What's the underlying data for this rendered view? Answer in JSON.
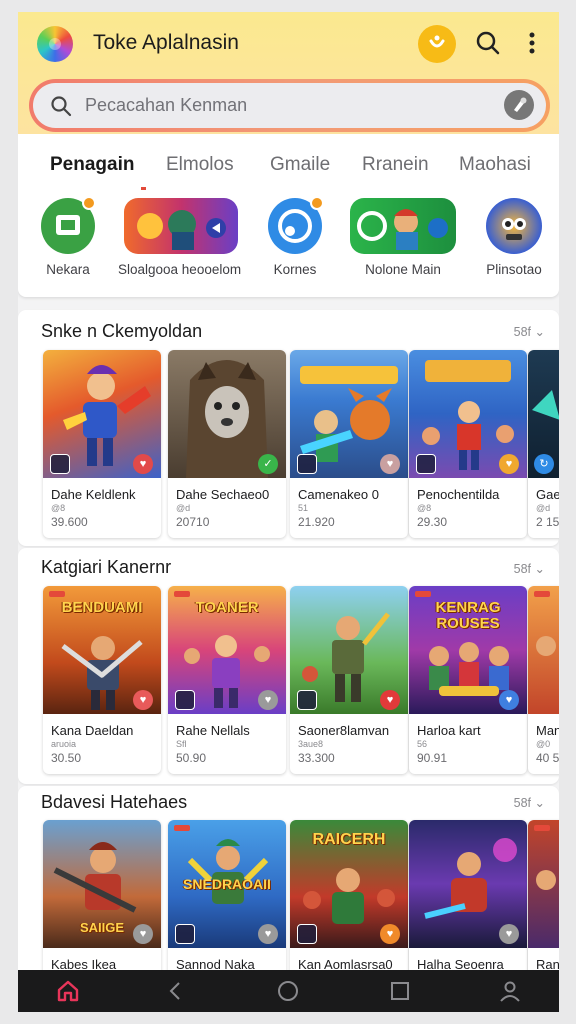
{
  "header": {
    "app_title": "Toke Aplalnasin",
    "icons": [
      "app-logo",
      "notification-icon",
      "search-icon",
      "more-icon"
    ]
  },
  "search": {
    "placeholder": "Pecacahan Kenman",
    "icon": "search-icon",
    "right_icon": "mic-icon"
  },
  "tabs": [
    {
      "label": "Penagain",
      "active": true
    },
    {
      "label": "Elmolos",
      "active": false
    },
    {
      "label": "Gmaile",
      "active": false
    },
    {
      "label": "Rranein",
      "active": false
    },
    {
      "label": "Maohasi",
      "active": false
    }
  ],
  "categories": [
    {
      "label": "Nekara",
      "color": "#3aa144"
    },
    {
      "label": "Sloalgooa heooelom",
      "color": "#e24c3c"
    },
    {
      "label": "Kornes",
      "color": "#2f8be5"
    },
    {
      "label": "Nolone Main",
      "color": "#2eb04a"
    },
    {
      "label": "Plinsotao",
      "color": "#3a5fd0"
    }
  ],
  "sections": [
    {
      "title": "Snke n Ckemyoldan",
      "more": "58f",
      "cards": [
        {
          "title": "Dahe Keldlenk",
          "sub": "@8",
          "value": "39.600",
          "fav_color": "#e24a4a"
        },
        {
          "title": "Dahe Sechaeo0",
          "sub": "@d",
          "value": "20710",
          "fav_color": "#39b54a"
        },
        {
          "title": "Camenakeo 0",
          "sub": "51",
          "value": "21.920",
          "fav_color": "#c9a0a0"
        },
        {
          "title": "Penochentilda",
          "sub": "@8",
          "value": "29.30",
          "fav_color": "#f0a830"
        },
        {
          "title": "Gae",
          "sub": "@d",
          "value": "2 15",
          "fav_color": "#2f8be5"
        }
      ]
    },
    {
      "title": "Katgiari Kanernr",
      "more": "58f",
      "cards": [
        {
          "title": "Kana Daeldan",
          "sub": "aruoia",
          "value": "30.50",
          "fav_color": "#e85a5a",
          "wordmark": "BENDUAMI"
        },
        {
          "title": "Rahe Nellals",
          "sub": "Sfl",
          "value": "50.90",
          "fav_color": "#9a9a9a",
          "wordmark": "TOANER"
        },
        {
          "title": "Saoner8lamvan",
          "sub": "3aue8",
          "value": "33.300",
          "fav_color": "#e23a3a"
        },
        {
          "title": "Harloa kart",
          "sub": "56",
          "value": "90.91",
          "fav_color": "#3f7fe0",
          "wordmark": "KENRAG ROUSES"
        },
        {
          "title": "Man",
          "sub": "@0",
          "value": "40 5",
          "fav_color": "#e24a4a"
        }
      ]
    },
    {
      "title": "Bdavesi Hatehaes",
      "more": "58f",
      "cards": [
        {
          "title": "Kabes Ikea",
          "fav_color": "#9a9a9a",
          "wordmark": "SAIIGE"
        },
        {
          "title": "Sannod Naka",
          "fav_color": "#9a9a9a",
          "wordmark": "SNEDRAOAII"
        },
        {
          "title": "Kan Aomlasrsa0",
          "fav_color": "#f08a2a",
          "wordmark": "RAICERH"
        },
        {
          "title": "Halha Seoenra",
          "fav_color": "#9a9a9a"
        },
        {
          "title": "Ran",
          "fav_color": "#9a9a9a"
        }
      ]
    }
  ],
  "navbar": {
    "items": [
      "home-icon",
      "back-icon",
      "circle-home-icon",
      "recents-icon",
      "profile-icon"
    ],
    "active_color": "#e8355a"
  }
}
